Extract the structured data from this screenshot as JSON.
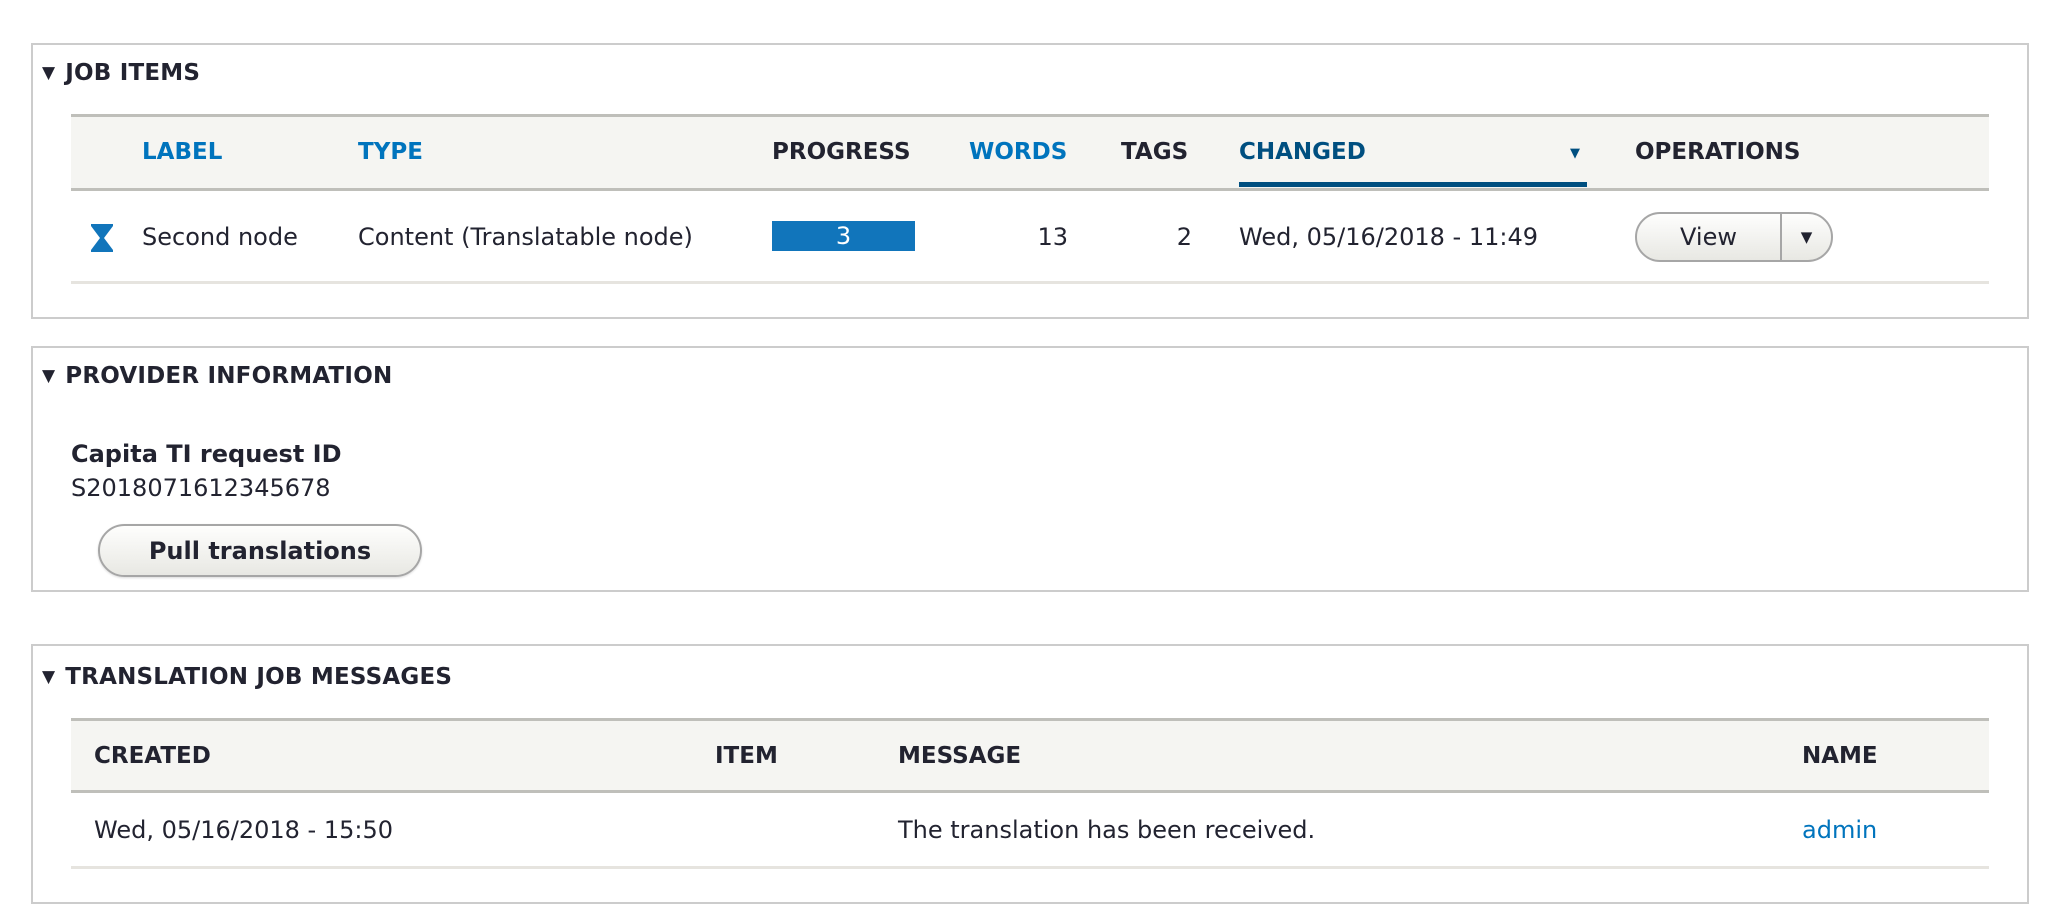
{
  "job_items": {
    "title": "JOB ITEMS",
    "columns": {
      "label": "LABEL",
      "type": "TYPE",
      "progress": "PROGRESS",
      "words": "WORDS",
      "tags": "TAGS",
      "changed": "CHANGED",
      "operations": "OPERATIONS"
    },
    "sort_indicator": "▼",
    "rows": [
      {
        "state_icon": "hourglass-icon",
        "label": "Second node",
        "type": "Content (Translatable node)",
        "progress_label": "3",
        "progress_fill_percent": 100,
        "words": "13",
        "tags": "2",
        "changed": "Wed, 05/16/2018 - 11:49",
        "operation": "View",
        "operation_toggle": "▼"
      }
    ]
  },
  "provider": {
    "title": "PROVIDER INFORMATION",
    "field_label": "Capita TI request ID",
    "field_value": "S2018071612345678",
    "button": "Pull translations"
  },
  "messages": {
    "title": "TRANSLATION JOB MESSAGES",
    "columns": {
      "created": "CREATED",
      "item": "ITEM",
      "message": "MESSAGE",
      "name": "NAME"
    },
    "rows": [
      {
        "created": "Wed, 05/16/2018 - 15:50",
        "item": "",
        "message": "The translation has been received.",
        "name": "admin"
      }
    ]
  },
  "colors": {
    "accent": "#0074bd",
    "active_sort": "#004f80",
    "progress": "#1175bb"
  },
  "collapse_glyph": "▼"
}
